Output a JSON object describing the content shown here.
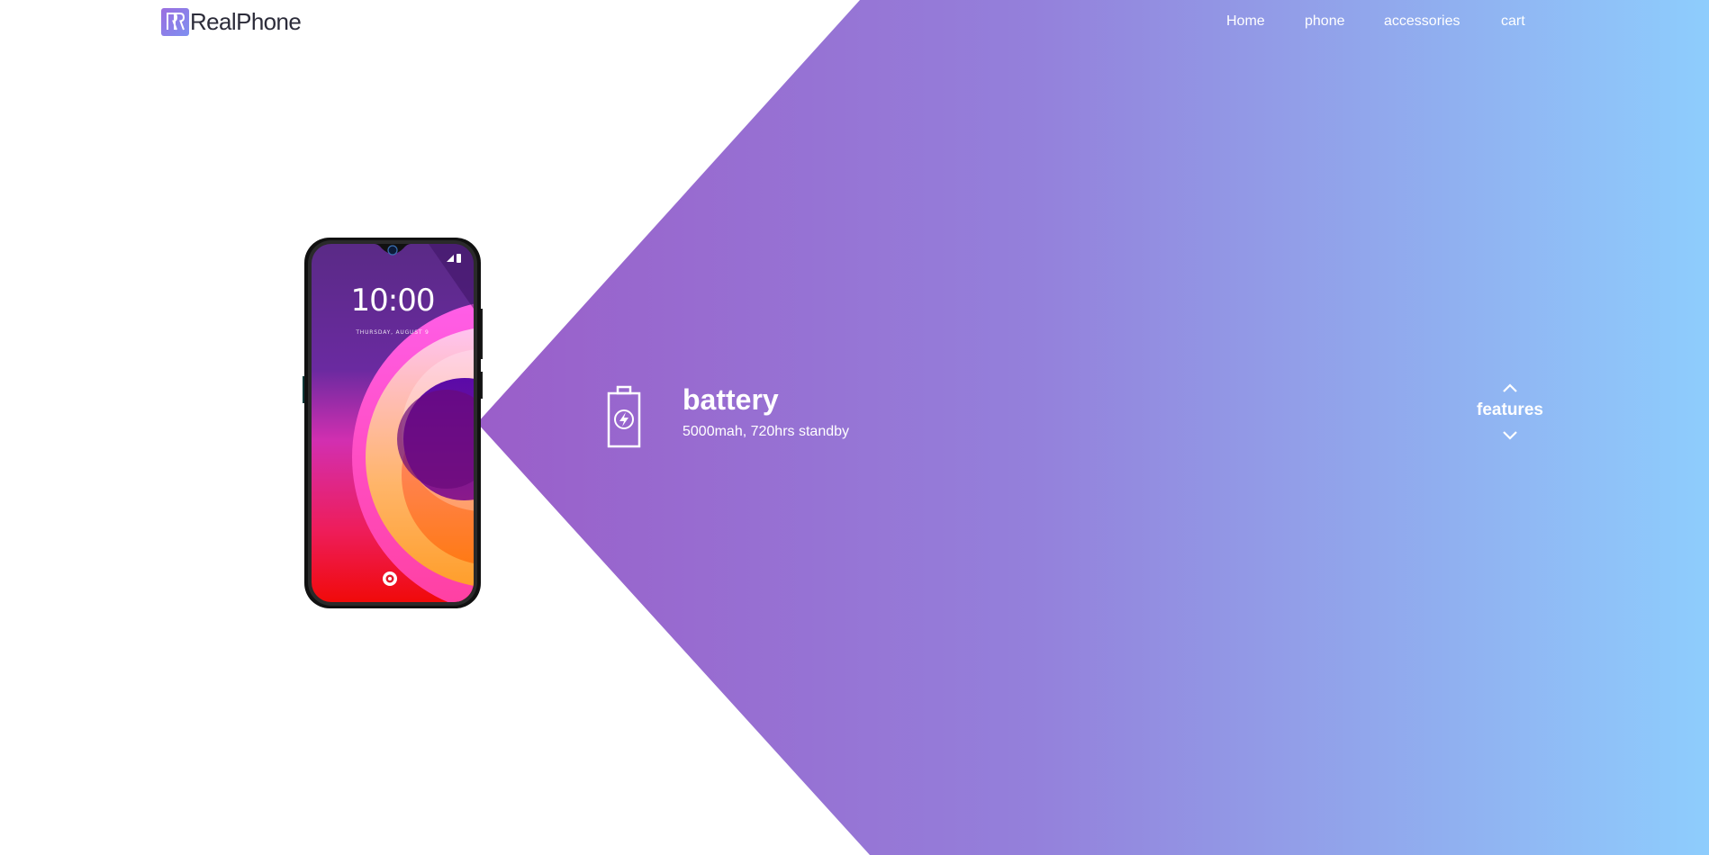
{
  "brand": {
    "logo_icon": "rr-monogram-icon",
    "name": "RealPhone"
  },
  "nav": {
    "items": [
      "Home",
      "phone",
      "accessories",
      "cart"
    ]
  },
  "phone_image": {
    "clock": "10:00",
    "date": "THURSDAY, AUGUST 9"
  },
  "feature": {
    "icon": "battery-charging-icon",
    "title": "battery",
    "description": "5000mah, 720hrs standby"
  },
  "section_switcher": {
    "label": "features",
    "prev_icon": "chevron-up-icon",
    "next_icon": "chevron-down-icon"
  },
  "colors": {
    "gradient_start": "#9a5ec9",
    "gradient_end": "#8ecdfd",
    "text_on_gradient": "#ffffff",
    "brand_text": "#2c2c3a"
  }
}
